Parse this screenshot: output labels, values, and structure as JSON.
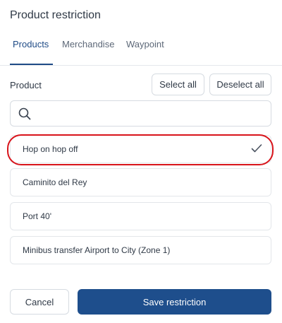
{
  "dialog": {
    "title": "Product restriction"
  },
  "tabs": [
    {
      "label": "Products",
      "active": true
    },
    {
      "label": "Merchandise",
      "active": false
    },
    {
      "label": "Waypoint",
      "active": false
    }
  ],
  "products_section": {
    "label": "Product",
    "select_all_label": "Select all",
    "deselect_all_label": "Deselect all",
    "search": {
      "value": "",
      "placeholder": "",
      "icon": "search-icon"
    }
  },
  "items": [
    {
      "label": "Hop on hop off",
      "selected": true
    },
    {
      "label": "Caminito del Rey",
      "selected": false
    },
    {
      "label": "Port 40'",
      "selected": false
    },
    {
      "label": "Minibus transfer Airport to City (Zone 1)",
      "selected": false
    }
  ],
  "footer": {
    "cancel_label": "Cancel",
    "save_label": "Save restriction"
  },
  "colors": {
    "accent": "#1e4e8c",
    "highlight": "#d8141b",
    "border": "#d6dbe1"
  }
}
